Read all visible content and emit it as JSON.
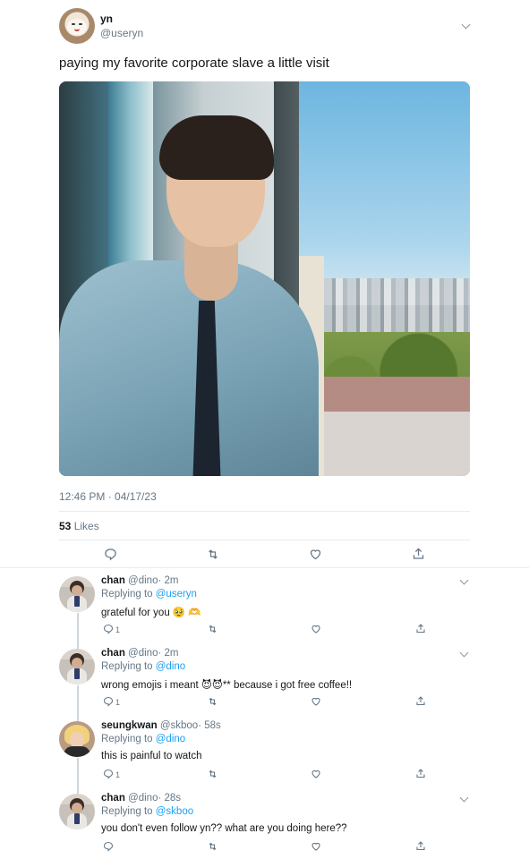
{
  "main": {
    "name": "yn",
    "handle": "@useryn",
    "text": "paying my favorite corporate slave a little visit",
    "timestamp": "12:46 PM · 04/17/23",
    "likes_count": "53",
    "likes_label": "Likes"
  },
  "replies": [
    {
      "name": "chan",
      "handle": "@dino",
      "time": "· 2m",
      "replying_prefix": "Replying to",
      "replying_to": "@useryn",
      "text": "grateful for you 🥹 🫶",
      "reply_count": "1"
    },
    {
      "name": "chan",
      "handle": "@dino",
      "time": "· 2m",
      "replying_prefix": "Replying to",
      "replying_to": "@dino",
      "text": "wrong emojis i meant 😈😈** because i got free coffee!!",
      "reply_count": "1"
    },
    {
      "name": "seungkwan",
      "handle": "@skboo",
      "time": "· 58s",
      "replying_prefix": "Replying to",
      "replying_to": "@dino",
      "text": "this is painful to watch",
      "reply_count": "1"
    },
    {
      "name": "chan",
      "handle": "@dino",
      "time": "· 28s",
      "replying_prefix": "Replying to",
      "replying_to": "@skboo",
      "text": "you don't even follow yn?? what are you doing here??",
      "reply_count": ""
    }
  ],
  "icons": {
    "reply": "reply-icon",
    "retweet": "retweet-icon",
    "like": "like-icon",
    "share": "share-icon",
    "more": "chevron-down-icon"
  },
  "colors": {
    "link": "#1da1f2",
    "secondary_text": "#657786",
    "divider": "#e6ecf0"
  }
}
